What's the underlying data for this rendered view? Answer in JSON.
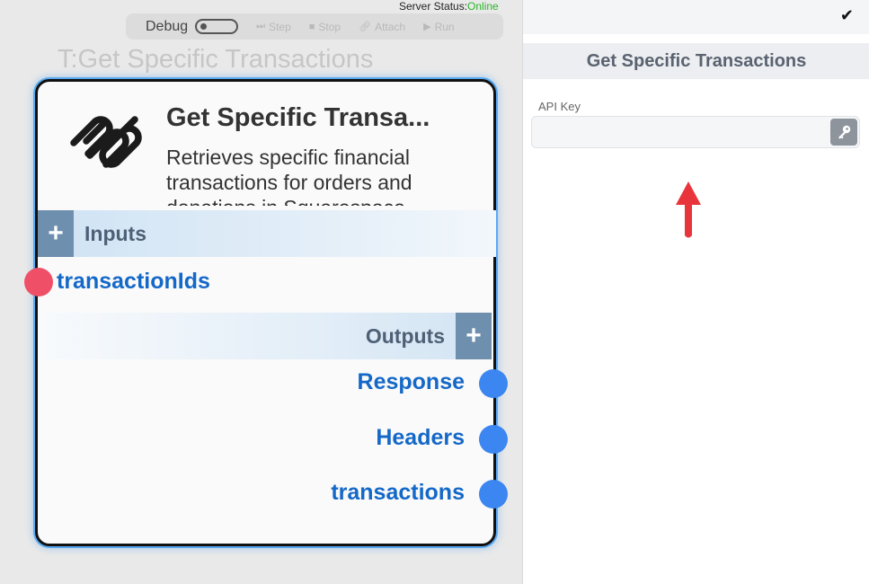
{
  "server_status": {
    "label": "Server Status:",
    "value": "Online",
    "value_color": "#2bb52b"
  },
  "toolbar": {
    "debug_label": "Debug",
    "debug_enabled": false,
    "buttons": [
      {
        "label": "Step",
        "icon": "step-icon"
      },
      {
        "label": "Stop",
        "icon": "stop-icon"
      },
      {
        "label": "Attach",
        "icon": "link-icon"
      },
      {
        "label": "Run",
        "icon": "play-icon"
      }
    ]
  },
  "node": {
    "canvas_title": "T:Get Specific Transactions",
    "name": "Get Specific Transa...",
    "description": "Retrieves specific financial transactions for orders and donations in Squarespace",
    "logo_icon": "squarespace-logo",
    "inputs_label": "Inputs",
    "inputs": [
      {
        "label": "transactionIds"
      }
    ],
    "outputs_label": "Outputs",
    "outputs": [
      {
        "label": "Response"
      },
      {
        "label": "Headers"
      },
      {
        "label": "transactions"
      }
    ],
    "accent_color": "#1468c8",
    "input_port_color": "#ef5068",
    "output_port_color": "#3b86f0"
  },
  "panel": {
    "check_icon": "✔",
    "title": "Get Specific Transactions",
    "api_key_label": "API Key",
    "api_key_value": "",
    "api_key_placeholder": "",
    "key_icon": "key-icon",
    "annotation_arrow_color": "#e8353b"
  }
}
